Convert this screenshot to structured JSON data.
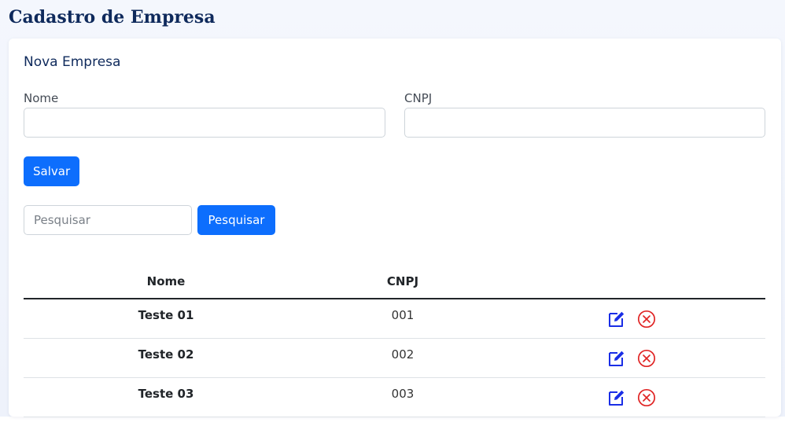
{
  "page": {
    "title": "Cadastro de Empresa"
  },
  "form": {
    "title": "Nova Empresa",
    "name_label": "Nome",
    "name_value": "",
    "cnpj_label": "CNPJ",
    "cnpj_value": "",
    "save_label": "Salvar"
  },
  "search": {
    "placeholder": "Pesquisar",
    "value": "",
    "button_label": "Pesquisar"
  },
  "table": {
    "columns": [
      "Nome",
      "CNPJ",
      ""
    ],
    "rows": [
      {
        "name": "Teste 01",
        "cnpj": "001",
        "actions": [
          "edit-icon",
          "delete-icon"
        ]
      },
      {
        "name": "Teste 02",
        "cnpj": "002",
        "actions": [
          "edit-icon",
          "delete-icon"
        ]
      },
      {
        "name": "Teste 03",
        "cnpj": "003",
        "actions": [
          "edit-icon",
          "delete-icon"
        ]
      }
    ]
  },
  "colors": {
    "primary": "#0d6efd",
    "title": "#0f2a5c",
    "edit_icon": "#1a2ee6",
    "delete_icon": "#e02424"
  }
}
